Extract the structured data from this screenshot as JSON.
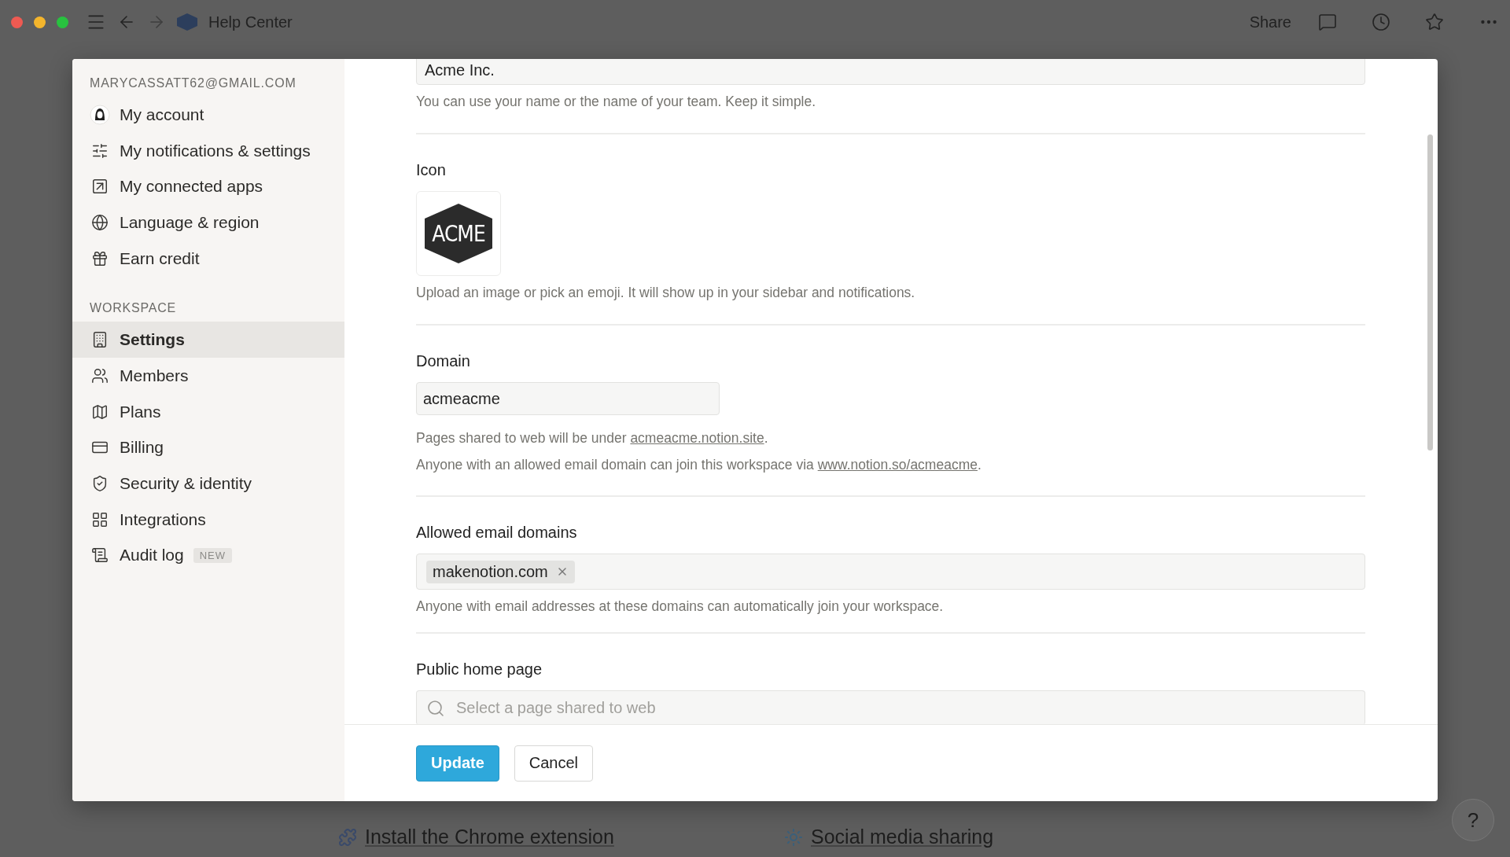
{
  "window": {
    "title": "Help Center"
  },
  "toolbar": {
    "share": "Share"
  },
  "background_links": [
    {
      "label": "Install the Chrome extension"
    },
    {
      "label": "Social media sharing"
    }
  ],
  "help_button": "?",
  "sidebar": {
    "account_email": "MARYCASSATT62@GMAIL.COM",
    "account_items": [
      {
        "label": "My account",
        "selected": false
      },
      {
        "label": "My notifications & settings",
        "selected": false
      },
      {
        "label": "My connected apps",
        "selected": false
      },
      {
        "label": "Language & region",
        "selected": false
      },
      {
        "label": "Earn credit",
        "selected": false
      }
    ],
    "workspace_heading": "WORKSPACE",
    "workspace_items": [
      {
        "label": "Settings",
        "selected": true
      },
      {
        "label": "Members",
        "selected": false
      },
      {
        "label": "Plans",
        "selected": false
      },
      {
        "label": "Billing",
        "selected": false
      },
      {
        "label": "Security & identity",
        "selected": false
      },
      {
        "label": "Integrations",
        "selected": false
      },
      {
        "label": "Audit log",
        "selected": false,
        "badge": "NEW"
      }
    ]
  },
  "settings": {
    "name": {
      "value": "Acme Inc.",
      "hint": "You can use your name or the name of your team. Keep it simple."
    },
    "icon": {
      "label": "Icon",
      "logo_text": "ACME",
      "hint": "Upload an image or pick an emoji. It will show up in your sidebar and notifications."
    },
    "domain": {
      "label": "Domain",
      "value": "acmeacme",
      "hints": [
        {
          "before": "Pages shared to web will be under ",
          "link": "acmeacme.notion.site",
          "after": "."
        },
        {
          "before": "Anyone with an allowed email domain can join this workspace via ",
          "link": "www.notion.so/acmeacme",
          "after": "."
        }
      ]
    },
    "allowed_domains": {
      "label": "Allowed email domains",
      "tags": [
        "makenotion.com"
      ],
      "hint": "Anyone with email addresses at these domains can automatically join your workspace."
    },
    "public_home_page": {
      "label": "Public home page",
      "placeholder": "Select a page shared to web"
    }
  },
  "footer_buttons": [
    {
      "label": "Update",
      "kind": "primary"
    },
    {
      "label": "Cancel",
      "kind": "secondary"
    }
  ]
}
